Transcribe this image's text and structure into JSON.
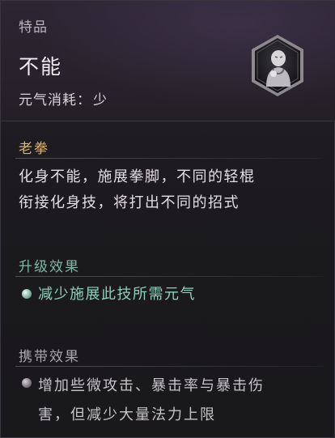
{
  "header": {
    "grade": "特品",
    "title": "不能",
    "cost_label": "元气消耗：",
    "cost_value": "少",
    "emblem_icon": "monk-portrait-icon"
  },
  "sections": {
    "lao_quan": {
      "title": "老拳",
      "line1": "化身不能，施展拳脚，不同的轻棍",
      "line2": "衔接化身技，将打出不同的招式"
    },
    "upgrade": {
      "title": "升级效果",
      "item": "减少施展此技所需元气"
    },
    "carry": {
      "title": "携带效果",
      "line1": "增加些微攻击、暴击率与暴击伤",
      "line2": "害，但减少大量法力上限"
    }
  },
  "colors": {
    "gold": "#d8b36e",
    "teal": "#8fd1bc",
    "text": "#e3dfe4"
  }
}
